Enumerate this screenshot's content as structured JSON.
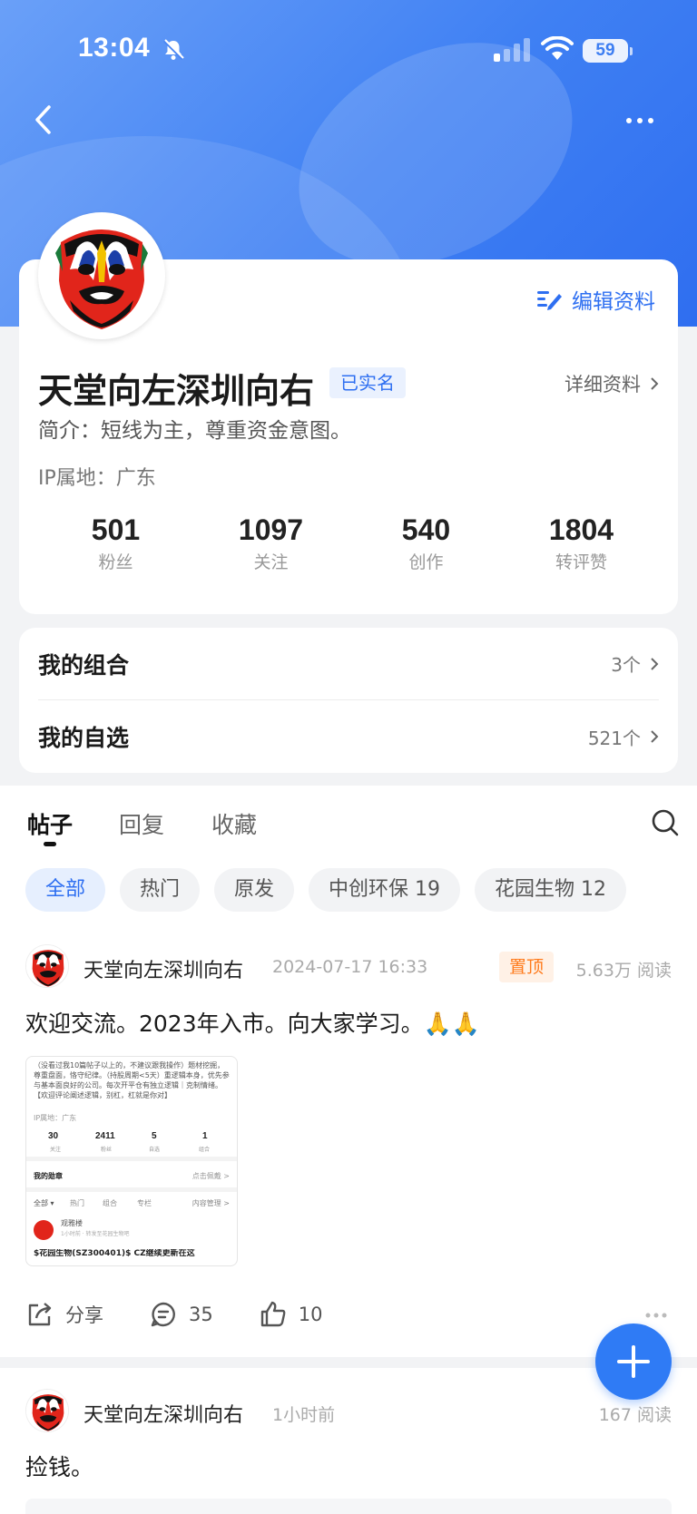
{
  "status_bar": {
    "time": "13:04",
    "battery": "59",
    "icons": [
      "bell-slash-icon",
      "signal-icon",
      "wifi-icon",
      "battery-icon"
    ]
  },
  "nav": {
    "back_icon": "chevron-left-icon",
    "more_icon": "more-dots-icon"
  },
  "profile": {
    "edit_label": "编辑资料",
    "username": "天堂向左深圳向右",
    "verified": "已实名",
    "detail_label": "详细资料",
    "bio": "简介：短线为主，尊重资金意图。",
    "ip": "IP属地：广东",
    "stats": [
      {
        "value": "501",
        "label": "粉丝"
      },
      {
        "value": "1097",
        "label": "关注"
      },
      {
        "value": "540",
        "label": "创作"
      },
      {
        "value": "1804",
        "label": "转评赞"
      }
    ]
  },
  "lists": [
    {
      "title": "我的组合",
      "count": "3个"
    },
    {
      "title": "我的自选",
      "count": "521个"
    }
  ],
  "tabs": [
    "帖子",
    "回复",
    "收藏"
  ],
  "filters": [
    "全部",
    "热门",
    "原发",
    "中创环保 19",
    "花园生物 12"
  ],
  "posts": [
    {
      "author": "天堂向左深圳向右",
      "time": "2024-07-17 16:33",
      "pinned": "置顶",
      "reads": "5.63万 阅读",
      "text": "欢迎交流。2023年入市。向大家学习。",
      "emoji": "🙏🙏",
      "share": "分享",
      "comments": "35",
      "likes": "10",
      "thumbnail": {
        "intro": "（没看过我10篇帖子以上的，不建议跟我操作）题材挖掘，尊重盘面，恪守纪律。（持股周期<5天）重逻辑本身，优先参与基本面良好的公司。每次开平仓有独立逻辑｜克制情绪。【欢迎评论阐述逻辑，别杠，杠就是你对】",
        "ip": "IP属地：广东",
        "stats": [
          {
            "value": "30",
            "label": "关注"
          },
          {
            "value": "2411",
            "label": "粉丝"
          },
          {
            "value": "5",
            "label": "自选"
          },
          {
            "value": "1",
            "label": "组合"
          }
        ],
        "medal": "我的勋章",
        "medal_link": "点击佩戴 >",
        "tabs": [
          "全部 ▾",
          "热门",
          "组合",
          "专栏"
        ],
        "manage": "内容管理 >",
        "user": "观雅楼",
        "meta": "1小时前 · 转发至花园生物吧",
        "post_text": "$花园生物(SZ300401)$ CZ继续更新在这"
      }
    },
    {
      "author": "天堂向左深圳向右",
      "time": "1小时前",
      "reads": "167 阅读",
      "text": "捡钱。"
    }
  ],
  "colors": {
    "accent": "#2e6ff1",
    "banner": "#3f80f3",
    "pin": "#ff7a1a"
  }
}
